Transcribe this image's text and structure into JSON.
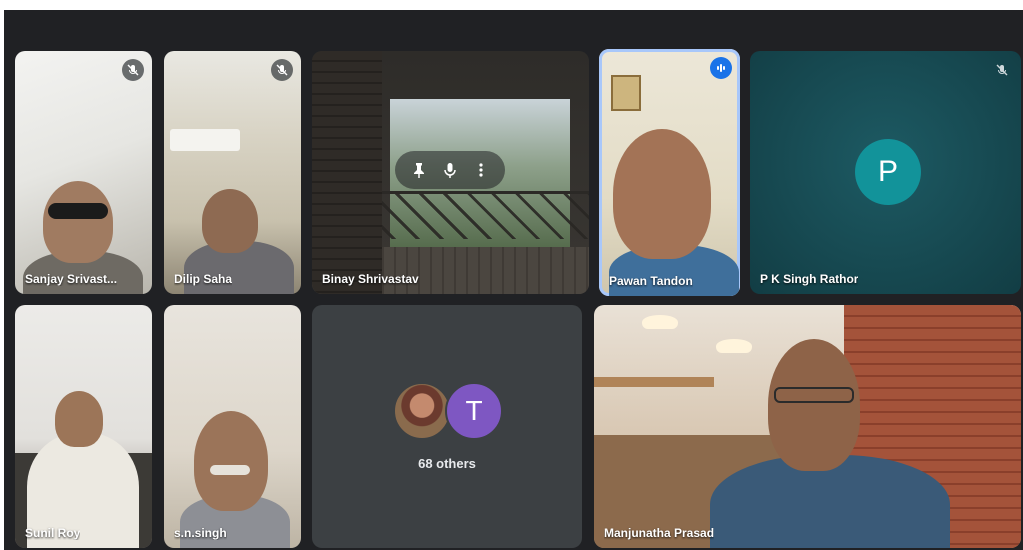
{
  "participants": [
    {
      "name": "Sanjay Srivast...",
      "muted": true
    },
    {
      "name": "Dilip Saha",
      "muted": true
    },
    {
      "name": "Binay Shrivastav",
      "muted": false
    },
    {
      "name": "Pawan Tandon",
      "muted": false,
      "speaking": true
    },
    {
      "name": "P K Singh Rathor",
      "muted": true,
      "avatar_letter": "P",
      "avatar_color": "#12939a"
    },
    {
      "name": "Sunil Roy",
      "muted": false
    },
    {
      "name": "s.n.singh",
      "muted": false
    },
    {
      "name": "Manjunatha Prasad",
      "muted": false
    }
  ],
  "others_tile": {
    "avatar_letter": "T",
    "avatar_color": "#7e57c2",
    "label": "68 others"
  },
  "tile_controls": [
    "pin-icon",
    "microphone-icon",
    "more-options-icon"
  ],
  "colors": {
    "background": "#202124",
    "tile": "#3c4043",
    "speaking_outline": "#a8c7fa"
  }
}
